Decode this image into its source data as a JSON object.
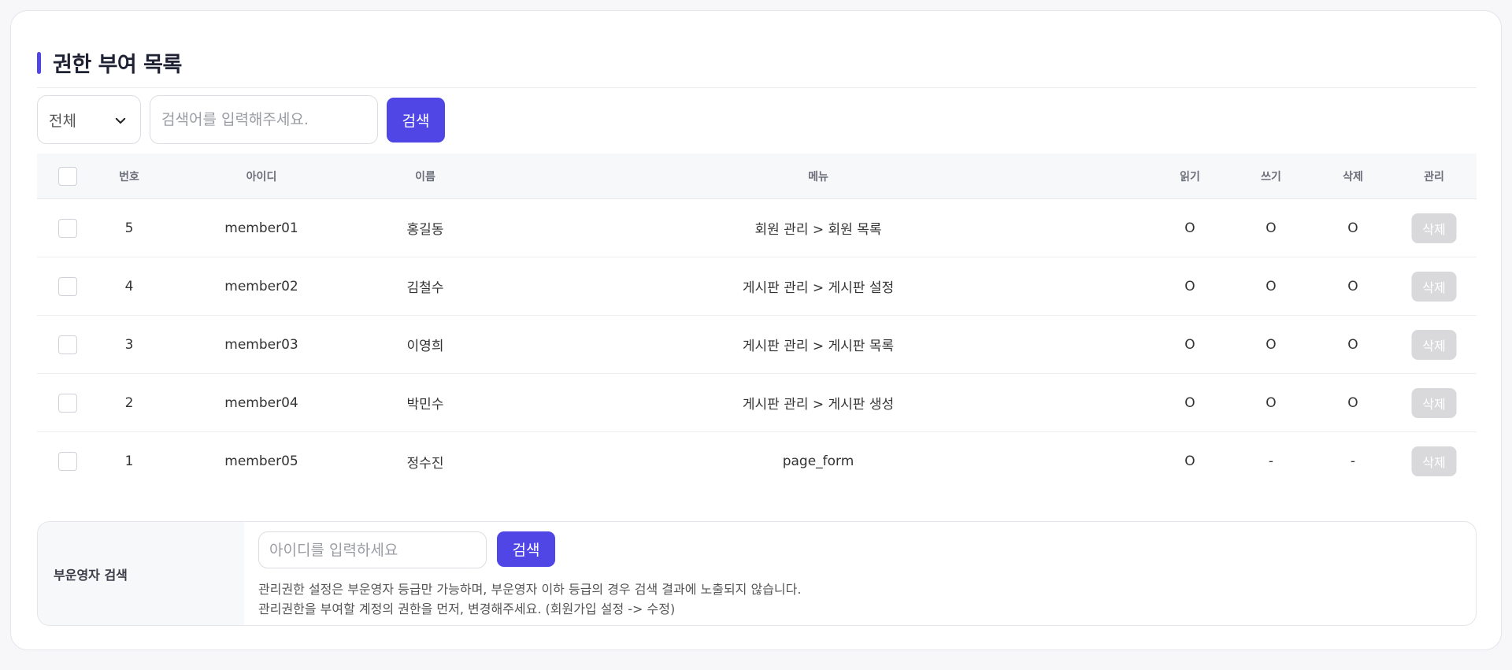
{
  "page_title": "권한 부여 목록",
  "filter": {
    "select_value": "전체",
    "search_placeholder": "검색어를 입력해주세요.",
    "search_button": "검색"
  },
  "table": {
    "headers": {
      "no": "번호",
      "id": "아이디",
      "name": "이름",
      "menu": "메뉴",
      "read": "읽기",
      "write": "쓰기",
      "delete": "삭제",
      "manage": "관리"
    },
    "rows": [
      {
        "no": "5",
        "id": "member01",
        "name": "홍길동",
        "menu": "회원 관리 > 회원 목록",
        "read": "O",
        "write": "O",
        "delete": "O",
        "action": "삭제"
      },
      {
        "no": "4",
        "id": "member02",
        "name": "김철수",
        "menu": "게시판 관리 > 게시판 설정",
        "read": "O",
        "write": "O",
        "delete": "O",
        "action": "삭제"
      },
      {
        "no": "3",
        "id": "member03",
        "name": "이영희",
        "menu": "게시판 관리 > 게시판 목록",
        "read": "O",
        "write": "O",
        "delete": "O",
        "action": "삭제"
      },
      {
        "no": "2",
        "id": "member04",
        "name": "박민수",
        "menu": "게시판 관리 > 게시판 생성",
        "read": "O",
        "write": "O",
        "delete": "O",
        "action": "삭제"
      },
      {
        "no": "1",
        "id": "member05",
        "name": "정수진",
        "menu": "page_form",
        "read": "O",
        "write": "-",
        "delete": "-",
        "action": "삭제"
      }
    ]
  },
  "admin_search": {
    "label": "부운영자 검색",
    "input_placeholder": "아이디를 입력하세요",
    "button": "검색",
    "note_line1": "관리권한 설정은 부운영자 등급만 가능하며, 부운영자 이하 등급의 경우 검색 결과에 노출되지 않습니다.",
    "note_line2": "관리권한을 부여할 계정의 권한을 먼저, 변경해주세요. (회원가입 설정 -> 수정)"
  },
  "colors": {
    "accent": "#4f46e5",
    "disabled_button": "#d9d9dc"
  },
  "icons": {
    "select_arrow": "chevron-down-icon"
  }
}
